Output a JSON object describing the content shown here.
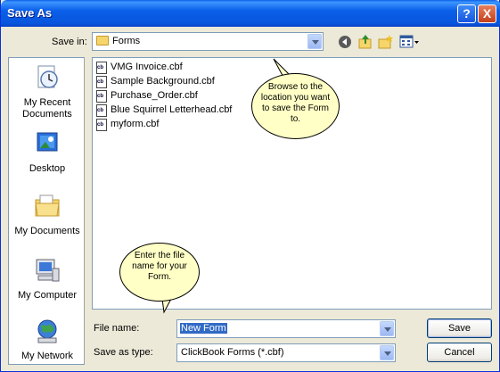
{
  "window": {
    "title": "Save As"
  },
  "titlebar": {
    "help": "?",
    "close": "X"
  },
  "savein": {
    "label": "Save in:",
    "value": "Forms"
  },
  "places": [
    {
      "label": "My Recent Documents",
      "icon": "recent-documents-icon"
    },
    {
      "label": "Desktop",
      "icon": "desktop-icon"
    },
    {
      "label": "My Documents",
      "icon": "my-documents-icon"
    },
    {
      "label": "My Computer",
      "icon": "my-computer-icon"
    },
    {
      "label": "My Network",
      "icon": "my-network-icon"
    }
  ],
  "files": [
    "VMG Invoice.cbf",
    "Sample Background.cbf",
    "Purchase_Order.cbf",
    "Blue Squirrel Letterhead.cbf",
    "myform.cbf"
  ],
  "callouts": {
    "browse": "Browse to the location you want to save the Form to.",
    "filename": "Enter the file name for your Form."
  },
  "filename": {
    "label": "File name:",
    "value": "New Form"
  },
  "savetype": {
    "label": "Save as type:",
    "value": "ClickBook Forms (*.cbf)"
  },
  "buttons": {
    "save": "Save",
    "cancel": "Cancel"
  },
  "colors": {
    "titlebar": "#0A5FE8",
    "dialog": "#ECE9D8",
    "selection": "#316AC5",
    "callout": "#FFFFC6"
  }
}
